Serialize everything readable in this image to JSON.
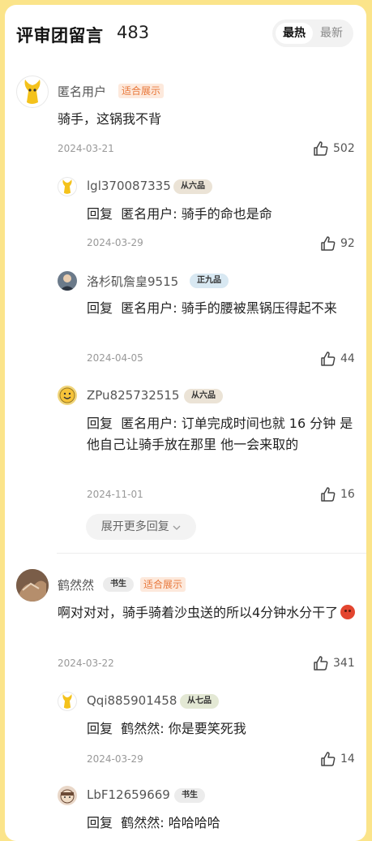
{
  "header": {
    "title": "评审团留言",
    "count": "483",
    "sort_hot": "最热",
    "sort_new": "最新"
  },
  "comments": [
    {
      "username": "匿名用户",
      "badge": "适合展示",
      "text": "骑手，这锅我不背",
      "date": "2024-03-21",
      "likes": "502",
      "replies": [
        {
          "username": "lgl370087335",
          "rank": "从六品",
          "prefix": "回复",
          "target": "匿名用户:",
          "text": "骑手的命也是命",
          "date": "2024-03-29",
          "likes": "92"
        },
        {
          "username": "洛杉矶詹皇9515",
          "rank": "正九品",
          "prefix": "回复",
          "target": "匿名用户:",
          "text": "骑手的腰被黑锅压得起不来",
          "date": "2024-04-05",
          "likes": "44"
        },
        {
          "username": "ZPu825732515",
          "rank": "从六品",
          "prefix": "回复",
          "target": "匿名用户:",
          "text": "订单完成时间也就 16 分钟 是他自己让骑手放在那里 他一会来取的",
          "date": "2024-11-01",
          "likes": "16"
        }
      ],
      "expand_label": "展开更多回复"
    },
    {
      "username": "鹤然然",
      "rank": "书生",
      "badge": "适合展示",
      "text": "啊对对对，骑手骑着沙虫送的所以4分钟水分干了",
      "date": "2024-03-22",
      "likes": "341",
      "replies": [
        {
          "username": "Qqi885901458",
          "rank": "从七品",
          "prefix": "回复",
          "target": "鹤然然:",
          "text": "你是要笑死我",
          "date": "2024-03-29",
          "likes": "14"
        },
        {
          "username": "LbF12659669",
          "rank": "书生",
          "prefix": "回复",
          "target": "鹤然然:",
          "text": "哈哈哈哈"
        }
      ]
    }
  ],
  "icons": [
    "thumbs-up-icon",
    "chevron-down-icon",
    "angry-emoji-icon"
  ]
}
